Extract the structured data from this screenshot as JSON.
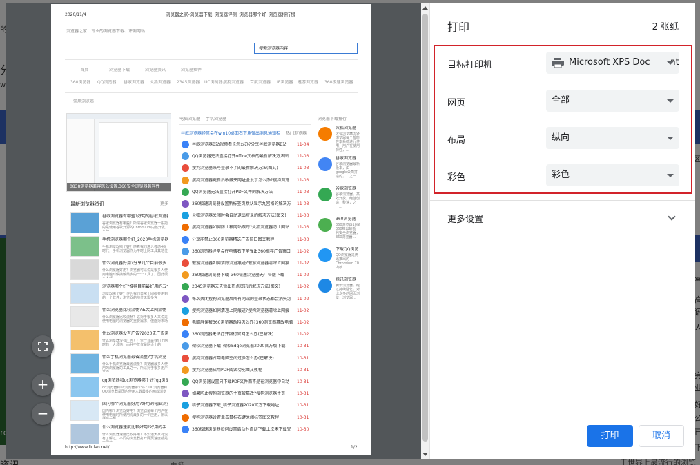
{
  "sheet": {
    "date": "2020/11/4",
    "header_title": "浏览器之家-浏览器下载_浏览器评测_浏览器哪个好_浏览器排行榜",
    "site_tagline": "浏览器之家：专业的浏览器下载、评测网站",
    "search_placeholder": "搜索浏览器内容",
    "nav_row1": [
      "首页",
      "浏览器下载",
      "浏览器资讯",
      "浏览器插件"
    ],
    "nav_row2": [
      "360浏览器",
      "QQ浏览器",
      "谷歌浏览器",
      "火狐浏览器",
      "2345浏览器",
      "UC浏览器",
      "搜狗浏览器",
      "百度浏览器",
      "IE浏览器",
      "遨游浏览器",
      "360极速浏览器"
    ],
    "nav_row3": "常用浏览器",
    "feature_caption": "0838浏览器兼容怎么设置,360安全浏览器兼容性",
    "mid_tabs": [
      "电脑浏览器",
      "手机浏览器"
    ],
    "headline": "谷歌浏览器经常会在win10桌面右下角弹出消息通知栏",
    "headline_tag": "热门浏览器",
    "articles": [
      {
        "title": "谷歌浏览器B站视频看卡怎么办?分享谷歌浏览器B站",
        "date": "11-04"
      },
      {
        "title": "QQ浏览器无法直接打开office文档的最新解决方法图",
        "date": "11-03"
      },
      {
        "title": "搜狗浏览器账号登录不了的最新解决方法(图文)",
        "date": "11-03"
      },
      {
        "title": "搜狗浏览器更新后收藏夹网址全没了怎么办?搜狗浏览",
        "date": "11-03"
      },
      {
        "title": "QQ浏览器无法直接打开PDF文件的解决方法",
        "date": "11-03"
      },
      {
        "title": "360极速浏览器设置新标签页默认显示九宫格的解决方",
        "date": "11-03"
      },
      {
        "title": "火狐浏览器关闭时会自动退出登录的解决方法(图文)",
        "date": "11-03"
      },
      {
        "title": "搜狗浏览器如何防止被网站跟踪?火狐浏览器防止网站",
        "date": "11-03"
      },
      {
        "title": "分享能禁止360浏览器精选广告窗口图文教程",
        "date": "11-03"
      },
      {
        "title": "360浏览器经常会在电脑右下角弹出360推荐广告窗口",
        "date": "11-02"
      },
      {
        "title": "傲游浏览器如何清除浏览痕迹?傲游浏览器清除上网痕",
        "date": "11-02"
      },
      {
        "title": "360极速浏览器下载_360极速浏览器无广告版下载",
        "date": "11-02"
      },
      {
        "title": "2345浏览器天天弹出热点资讯的解决方法(图文)",
        "date": "11-02"
      },
      {
        "title": "每次关闭搜狗浏览器后所有网站的登录状态都会消失怎",
        "date": "11-02"
      },
      {
        "title": "搜狗浏览器如何清理上网痕迹?搜狗浏览器清除上网痕",
        "date": "11-02"
      },
      {
        "title": "电脑屏保被360浏览器劫持怎么办?360浏览器篡改电脑",
        "date": "11-02"
      },
      {
        "title": "360浏览器无法打开银行官网怎么办(已解决)",
        "date": "11-02"
      },
      {
        "title": "微软浏览器下载_微软Edge浏览器2020官方版下载",
        "date": "10-31"
      },
      {
        "title": "搜狗浏览器占用电脑空间过多怎么办(已解决)",
        "date": "10-31"
      },
      {
        "title": "搜狗浏览器启用PDF阅读功能图文教程",
        "date": "10-31"
      },
      {
        "title": "QQ浏览器设置只下载PDF文件而不是在浏览器中自动",
        "date": "10-31"
      },
      {
        "title": "如果防止搜狗浏览器的主页被篡改?搜狗浏览器主页",
        "date": "10-31"
      },
      {
        "title": "桔子浏览器下载_桔子浏览器2020官方下载地址",
        "date": "10-31"
      },
      {
        "title": "搜狗浏览器设置单击鼠标右键关闭标签图文教程",
        "date": "10-31"
      },
      {
        "title": "360极速浏览器如何设置启动时自动下载上次未下载完",
        "date": "10-30"
      }
    ],
    "news_header": "最新浏览器资讯",
    "news_more": "更多",
    "news": [
      {
        "title": "谷歌浏览器有哪些?好用的谷歌浏览器",
        "desc": "谷歌浏览器有哪些？所谓谷歌浏览器一般指的是使用谷歌开源的Chromium内核开发，在使"
      },
      {
        "title": "手机浏览器哪个好_2020手机浏览器",
        "desc": "手机浏览器哪个好？随着我们进入移动4G时代，手机浏览器作为平时上网工具其地位"
      },
      {
        "title": "什么浏览器好用?分享几个目前很多",
        "desc": "什么浏览器好用？浏览器可以说是很多人使用电脑时候接触最多的一个工具了，因此很多人都"
      },
      {
        "title": "浏览器哪个好?推荐目前最好用的五个",
        "desc": "浏览器哪个好？作为我们日常上网都要用到的一个软件，浏览器的地位无需多言"
      },
      {
        "title": "什么浏览器比较流畅?五大上网流畅",
        "desc": "什么浏览器比较流畅？这对于很多人来说是使用电脑时浏览器的重要需求，但面对市场"
      },
      {
        "title": "什么浏览器没有广告?2020无广告浏览器",
        "desc": "什么浏览器没有广告？广告一直是我们上网时的一大烦恼，而且不仅仅是网页上的"
      },
      {
        "title": "什么手机浏览器最省流量?手机浏览",
        "desc": "什么手机浏览器最省流量？浏览器最多人使用的浏览器的工具之一，所以对于很多用户来说"
      },
      {
        "title": "qq浏览器和uc浏览器哪个好?qq浏览器",
        "desc": "qq浏览器和uc浏览器哪个好？UC浏览器和QQ浏览器是国内使用人数最多的两款浏览"
      },
      {
        "title": "国内哪个浏览器好用?好用的电脑浏览",
        "desc": "国内哪个浏览器好用？浏览器是每个用户在使用电脑时所使用得最多的一个应用，所以选择一款"
      },
      {
        "title": "什么浏览器速度比较好用?好用的手",
        "desc": "什么浏览器速度比较好用？不知道大家有没有了解过，不同的浏览器打开网页速度都是不同的"
      }
    ],
    "right_header": "浏览器下载排行",
    "rank": [
      {
        "name": "火狐浏览器",
        "desc": "火狐浏览器国外浏览器每个都能在本系统进行使用，用户在使用特性，..."
      },
      {
        "name": "谷歌浏览器",
        "desc": "谷歌浏览器最新版本，由google公司打造的，...之一..."
      },
      {
        "name": "谷歌浏览器",
        "desc": "谷歌浏览器，高效开放，绝佳创造，秒速，之一..."
      },
      {
        "name": "360浏览器",
        "desc": "360浏览器10是360推出的新一代安全浏览器，360浏览器..."
      },
      {
        "name": "下载QQ浏览",
        "desc": "QQ浏览器是腾讯推出的Chromium 70内核..."
      },
      {
        "name": "腾讯浏览器",
        "desc": "腾讯浏览器，经过持续强化，对比众多的网页浏览，浏览器..."
      }
    ],
    "footer_url": "http://www.liulan.net/",
    "footer_page": "1/2"
  },
  "zoom": {
    "fit": "fit-to-page",
    "plus": "+",
    "minus": "−"
  },
  "settings": {
    "title": "打印",
    "sheet_count": "2 张纸",
    "destination_label": "目标打印机",
    "destination_value": "Microsoft XPS Document Writer",
    "pages_label": "网页",
    "pages_value": "全部",
    "layout_label": "布局",
    "layout_value": "纵向",
    "color_label": "彩色",
    "color_value": "彩色",
    "more_settings": "更多设置",
    "print_button": "打印",
    "cancel_button": "取消"
  },
  "background": {
    "left_fragments": [
      "的",
      "分",
      "w",
      "rc"
    ],
    "right_fragments": [
      "区",
      "ж",
      "高",
      "语",
      "人",
      "完",
      "业",
      "好",
      "公",
      "已",
      "下"
    ],
    "bottom_left": "资讯",
    "bottom_mid": "更多",
    "bottom_right": "于世界上最流行的浏览"
  },
  "colors": {
    "accent": "#1a73e8",
    "highlight_border": "#d2232a",
    "preview_bg": "#525659"
  }
}
